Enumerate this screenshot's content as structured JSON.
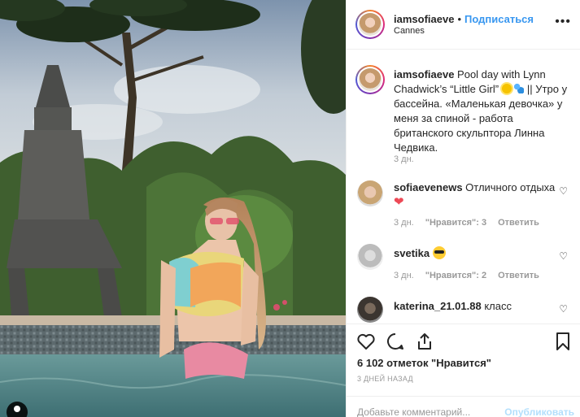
{
  "post": {
    "username": "iamsofiaeve",
    "separator": "•",
    "follow_label": "Подписаться",
    "location": "Cannes",
    "more_label": "•••"
  },
  "caption": {
    "username": "iamsofiaeve",
    "text_part1": " Pool day with Lynn Chadwick’s “Little Girl” ",
    "text_part2": " || Утро у бассейна. «Маленькая девочка» у меня за спиной - работа британского скульптора Линна Чедвика.",
    "time": "3 дн."
  },
  "comments": [
    {
      "username": "sofiaevenews",
      "text": " Отличного отдыха",
      "time": "3 дн.",
      "likes": "\"Нравится\": 3",
      "reply": "Ответить"
    },
    {
      "username": "svetika",
      "text": " ",
      "time": "3 дн.",
      "likes": "\"Нравится\": 2",
      "reply": "Ответить"
    },
    {
      "username": "katerina_21.01.88",
      "text": " класс"
    }
  ],
  "actions": {
    "likes_count": "6 102 отметок \"Нравится\"",
    "date": "3 ДНЕЙ НАЗАД",
    "comment_placeholder": "Добавьте комментарий...",
    "publish_label": "Опубликовать"
  },
  "icons": {
    "like": "heart-outline-icon",
    "comment": "speech-bubble-icon",
    "share": "share-icon",
    "save": "bookmark-icon",
    "more": "more-dots-icon",
    "user_tag": "user-tag-icon"
  },
  "colors": {
    "accent": "#3897f0",
    "text": "#262626",
    "muted": "#999999",
    "heart_red": "#ed4956",
    "publish_disabled": "#b2dffc"
  }
}
